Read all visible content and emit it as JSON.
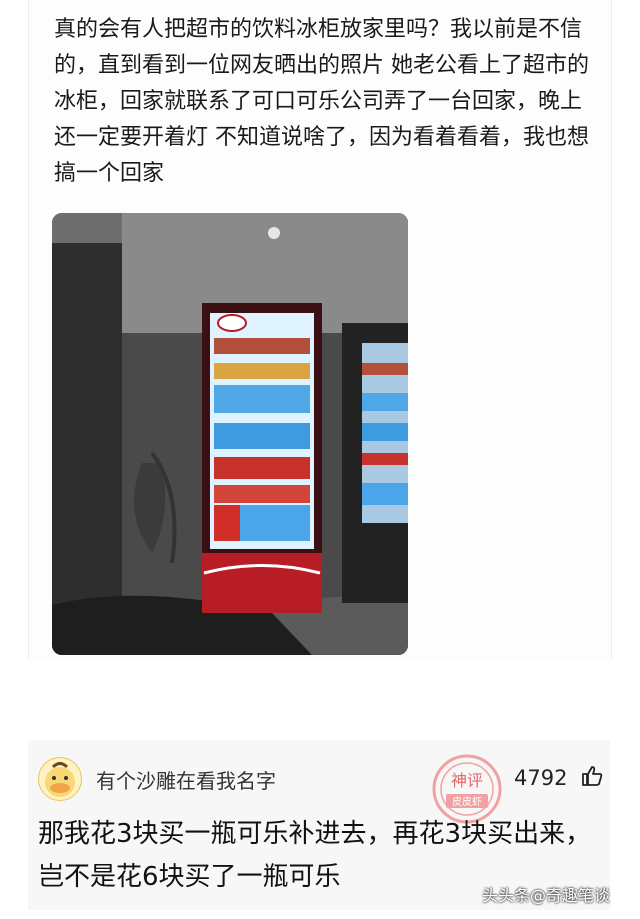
{
  "post": {
    "text": "真的会有人把超市的饮料冰柜放家里吗？我以前是不信的，直到看到一位网友晒出的照片 她老公看上了超市的冰柜，回家就联系了可口可乐公司弄了一台回家，晚上还一定要开着灯 不知道说啥了，因为看着看着，我也想搞一个回家",
    "photo_icon": "photo-of-drinks-fridge"
  },
  "comment": {
    "username": "有个沙雕在看我名字",
    "likes": "4792",
    "like_icon": "thumbs-up-icon",
    "stamp_text": "神评",
    "stamp_subtext": "皮皮虾",
    "text": "那我花3块买一瓶可乐补进去，再花3块买出来，岂不是花6块买了一瓶可乐"
  },
  "watermark": "头头条@奇趣笔谈",
  "colors": {
    "stamp_red": "#e8676a",
    "fridge_red": "#b81c24",
    "fridge_light": "#dff2ff"
  }
}
